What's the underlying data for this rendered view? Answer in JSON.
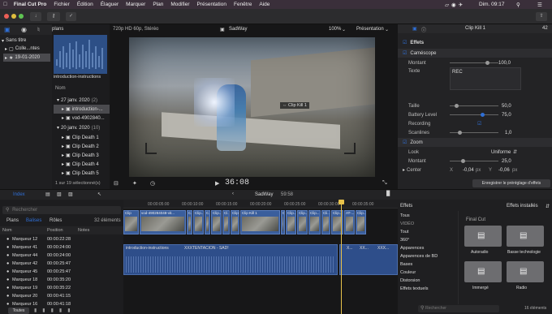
{
  "menubar": {
    "app": "Final Cut Pro",
    "items": [
      "Fichier",
      "Édition",
      "Élaguer",
      "Marquer",
      "Plan",
      "Modifier",
      "Présentation",
      "Fenêtre",
      "Aide"
    ],
    "clock": "Dim. 09:17"
  },
  "library": {
    "header": "plans",
    "items": [
      "Sans titre",
      "Colle...ntes",
      "19-01-2020"
    ]
  },
  "browser": {
    "section_label": "Nom",
    "clip_label": "introduction-instructions",
    "dates": [
      "27 janv. 2020",
      "20 janv. 2020"
    ],
    "date_counts": [
      "(2)",
      "(10)"
    ],
    "clips_a": [
      "introduction-...",
      "vod-4902840..."
    ],
    "clips_b": [
      "Clip Death 1",
      "Clip Death 2",
      "Clip Death 3",
      "Clip Death 4",
      "Clip Death 5"
    ],
    "footer": "1 sur 19 sélectionné(s)"
  },
  "viewer": {
    "format": "720p HD 60p, Stéréo",
    "project": "SadWay",
    "zoom": "100%",
    "presentation": "Présentation",
    "timecode": "36:08",
    "overlay_label": "Clip Kill 1"
  },
  "inspector": {
    "clip_name": "Clip Kill 1",
    "clip_number": "42",
    "effects_label": "Effets",
    "camcorder_label": "Caméscope",
    "amount_label": "Montant",
    "amount_value": "100,0",
    "text_label": "Texte",
    "text_value": "REC",
    "size_label": "Taille",
    "size_value": "50,0",
    "battery_label": "Battery Level",
    "battery_value": "75,0",
    "recording_label": "Recording",
    "scanlines_label": "Scanlines",
    "scanlines_value": "1,0",
    "zoom_label": "Zoom",
    "look_label": "Look",
    "look_value": "Uniforme",
    "zoom_amount_value": "25,0",
    "center_label": "Center",
    "center_x": "-0,04",
    "center_y": "-0,06",
    "unit_px": "px",
    "save_preset": "Enregistrer le préréglage d’effets"
  },
  "timeline_bar": {
    "index_label": "Index",
    "project": "SadWay",
    "duration": "59:58"
  },
  "index": {
    "tabs": [
      "Plans",
      "Balises",
      "Rôles"
    ],
    "count": "32 éléments",
    "search_placeholder": "Rechercher",
    "columns": [
      "Nom",
      "Position",
      "Notes"
    ],
    "rows": [
      {
        "name": "Marqueur 12",
        "pos": "00:00:22:28"
      },
      {
        "name": "Marqueur 41",
        "pos": "00:00:24:00"
      },
      {
        "name": "Marqueur 44",
        "pos": "00:00:24:00"
      },
      {
        "name": "Marqueur 42",
        "pos": "00:00:25:47"
      },
      {
        "name": "Marqueur 45",
        "pos": "00:00:25:47"
      },
      {
        "name": "Marqueur 18",
        "pos": "00:00:35:20"
      },
      {
        "name": "Marqueur 19",
        "pos": "00:00:35:22"
      },
      {
        "name": "Marqueur 20",
        "pos": "00:00:41:15"
      },
      {
        "name": "Marqueur 16",
        "pos": "00:00:41:18"
      }
    ],
    "footer_button": "Toutes"
  },
  "timeline": {
    "ruler": [
      "00:00:05:00",
      "00:00:10:00",
      "00:00:15:00",
      "00:00:20:00",
      "00:00:25:00",
      "00:00:30:00",
      "00:00:35:00",
      "00:00:40:00"
    ],
    "clip_labels": [
      "Clip",
      "vod-490284048-vit...",
      "C...",
      "Clip...",
      "C...",
      "Clip...",
      "Cl...",
      "Clip",
      "Clip Kill 1",
      "C",
      "Clip...",
      "Clip...",
      "Clip...",
      "Cli...",
      "Clip...",
      "AT-...",
      "Clip..."
    ],
    "audio_label": "introduction-instructions",
    "audio_label2": "XXXTENTACION - SAD!",
    "audio_labels_short": [
      "X...",
      "XX...",
      "XXX..."
    ]
  },
  "effects": {
    "title": "Effets",
    "installed": "Effets installés",
    "categories": [
      "Tous",
      "VIDÉO",
      "Tout",
      "360°",
      "Apparences",
      "Apparences de BD",
      "Bases",
      "Couleur",
      "Distorsion",
      "Effets textuels"
    ],
    "group": "Final Cut",
    "tiles": [
      "Autoradio",
      "Basse technologie",
      "Immergé",
      "Radio"
    ],
    "search_placeholder": "Rechercher",
    "count": "16 éléments"
  },
  "colors": {
    "accent": "#2f6fd6",
    "clip_blue": "#3a5e9c",
    "audio_blue": "#2e4e8a",
    "playhead": "#e8c24a"
  }
}
